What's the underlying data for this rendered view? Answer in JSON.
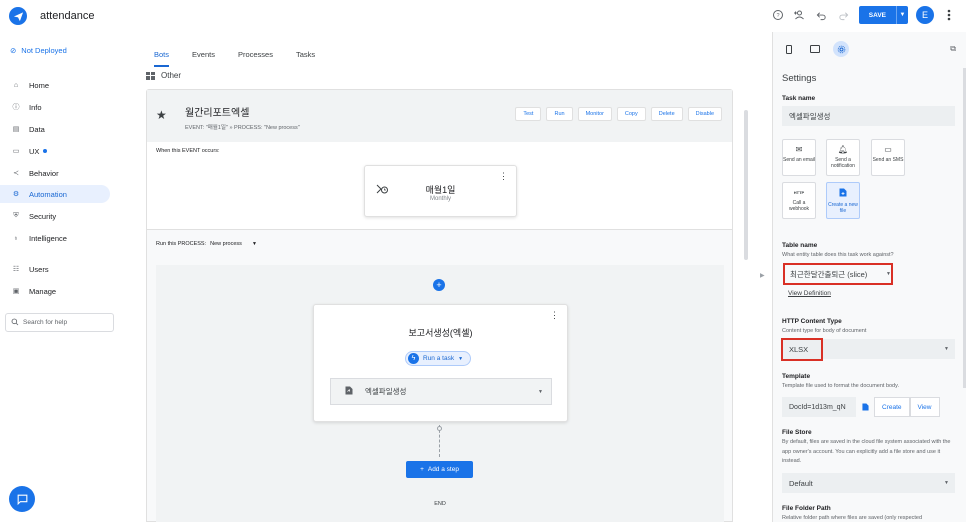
{
  "app": {
    "title": "attendance"
  },
  "topbar": {
    "save_label": "SAVE",
    "avatar_letter": "E"
  },
  "sidebar": {
    "deploy_status": "Not Deployed",
    "items": [
      {
        "label": "Home",
        "icon": "home-icon"
      },
      {
        "label": "Info",
        "icon": "info-icon"
      },
      {
        "label": "Data",
        "icon": "data-icon"
      },
      {
        "label": "UX",
        "icon": "ux-icon"
      },
      {
        "label": "Behavior",
        "icon": "behavior-icon"
      },
      {
        "label": "Automation",
        "icon": "automation-icon"
      },
      {
        "label": "Security",
        "icon": "security-icon"
      },
      {
        "label": "Intelligence",
        "icon": "intelligence-icon"
      },
      {
        "label": "Users",
        "icon": "users-icon"
      },
      {
        "label": "Manage",
        "icon": "manage-icon"
      }
    ],
    "active_item": "Automation",
    "search_placeholder": "Search for help"
  },
  "tabs": [
    "Bots",
    "Events",
    "Processes",
    "Tasks"
  ],
  "active_tab": "Bots",
  "group_label": "Other",
  "bot": {
    "title": "월간리포트엑셀",
    "subtitle": "EVENT: \"매월1일\" » PROCESS: \"New process\"",
    "actions": [
      "Test",
      "Run",
      "Monitor",
      "Copy",
      "Delete",
      "Disable"
    ],
    "when_label": "When this EVENT occurs:",
    "event_name": "매월1일",
    "event_freq": "Monthly",
    "process_label": "Run this PROCESS:",
    "process_name": "New process",
    "step_title": "보고서생성(엑셀)",
    "task_chip": "Run a task",
    "task_select": "엑셀파일생성",
    "add_step": "Add a step",
    "end_label": "END"
  },
  "settings": {
    "title": "Settings",
    "task_name_label": "Task name",
    "task_name_value": "엑셀파일생성",
    "task_options": [
      {
        "label": "Send an email",
        "icon": "mail-icon"
      },
      {
        "label": "Send a notification",
        "icon": "bell-icon"
      },
      {
        "label": "Send an SMS",
        "icon": "sms-icon"
      },
      {
        "label": "Call a webhook",
        "icon": "http-icon"
      },
      {
        "label": "Create a new file",
        "icon": "file-icon"
      }
    ],
    "selected_option": "Create a new file",
    "table_name_label": "Table name",
    "table_name_help": "What entity table does this task work against?",
    "table_name_value": "최근한달간출퇴근 (slice)",
    "view_definition": "View Definition",
    "http_label": "HTTP Content Type",
    "http_help": "Content type for body of document",
    "http_value": "XLSX",
    "template_label": "Template",
    "template_help": "Template file used to format the document body.",
    "template_value": "DocId=1d13m_qN",
    "template_create": "Create",
    "template_view": "View",
    "file_store_label": "File Store",
    "file_store_help": "By default, files are saved in the cloud file system associated with the app owner's account. You can explicitly add a file store and use it instead.",
    "file_store_value": "Default",
    "folder_label": "File Folder Path",
    "folder_help": "Relative folder path where files are saved (only respected"
  },
  "colors": {
    "accent": "#1a73e8",
    "highlight_box": "#d93025"
  }
}
